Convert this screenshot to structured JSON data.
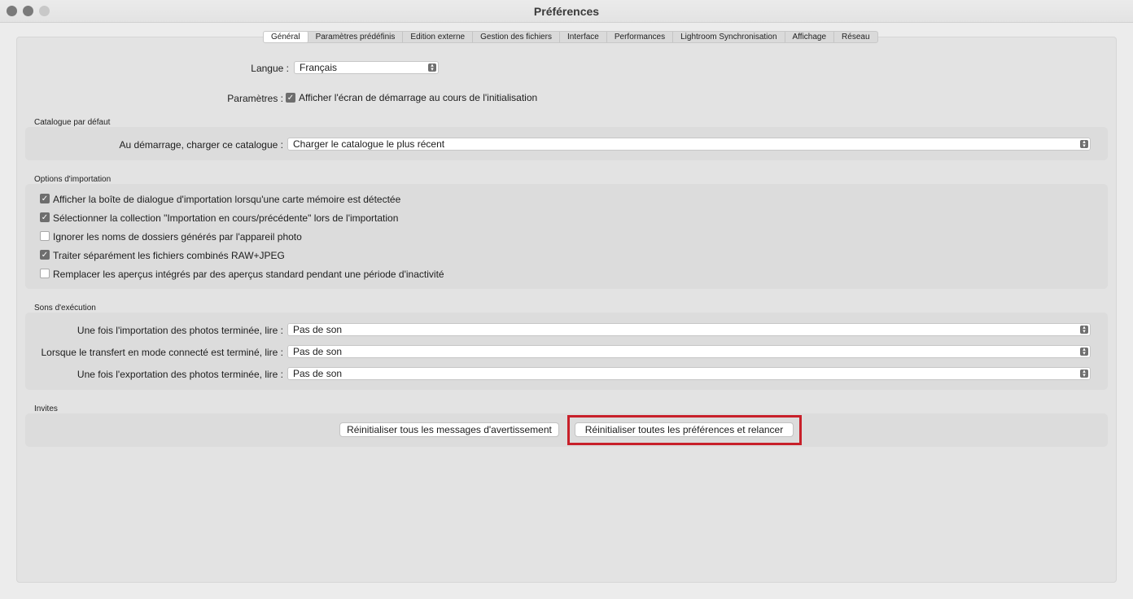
{
  "window": {
    "title": "Préférences"
  },
  "tabs": [
    "Général",
    "Paramètres prédéfinis",
    "Edition externe",
    "Gestion des fichiers",
    "Interface",
    "Performances",
    "Lightroom Synchronisation",
    "Affichage",
    "Réseau"
  ],
  "general": {
    "language_label": "Langue :",
    "language_value": "Français",
    "settings_label": "Paramètres :",
    "settings_checkbox_label": "Afficher l'écran de démarrage au cours de l'initialisation"
  },
  "catalog": {
    "section_title": "Catalogue par défaut",
    "label": "Au démarrage, charger ce catalogue :",
    "value": "Charger le catalogue le plus récent"
  },
  "import_options": {
    "section_title": "Options d'importation",
    "items": [
      {
        "label": "Afficher la boîte de dialogue d'importation lorsqu'une carte mémoire est détectée",
        "checked": true
      },
      {
        "label": "Sélectionner la collection \"Importation en cours/précédente\" lors de l'importation",
        "checked": true
      },
      {
        "label": "Ignorer les noms de dossiers générés par l'appareil photo",
        "checked": false
      },
      {
        "label": "Traiter séparément les fichiers combinés RAW+JPEG",
        "checked": true
      },
      {
        "label": "Remplacer les aperçus intégrés par des aperçus standard pendant une période d'inactivité",
        "checked": false
      }
    ]
  },
  "sounds": {
    "section_title": "Sons d'exécution",
    "rows": [
      {
        "label": "Une fois l'importation des photos terminée, lire :",
        "value": "Pas de son"
      },
      {
        "label": "Lorsque le transfert en mode connecté est terminé, lire :",
        "value": "Pas de son"
      },
      {
        "label": "Une fois l'exportation des photos terminée, lire :",
        "value": "Pas de son"
      }
    ]
  },
  "prompts": {
    "section_title": "Invites",
    "reset_warnings_button": "Réinitialiser tous les messages d'avertissement",
    "reset_prefs_button": "Réinitialiser toutes les préférences et relancer"
  },
  "colors": {
    "highlight": "#c8202a"
  }
}
